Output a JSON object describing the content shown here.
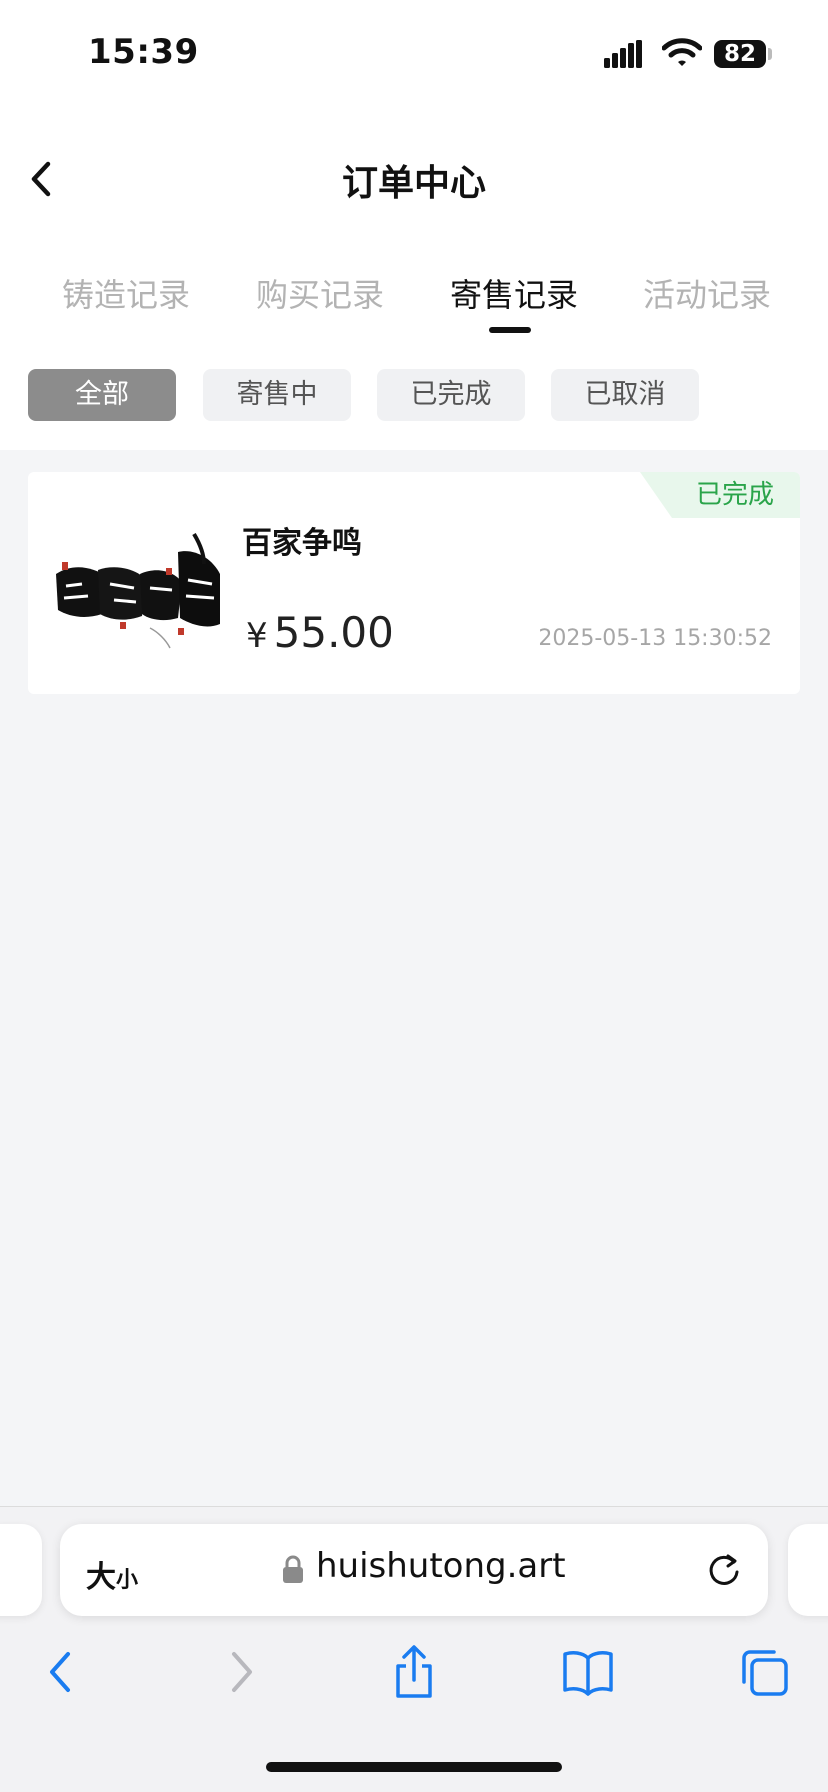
{
  "status_bar": {
    "time": "15:39",
    "battery": "82"
  },
  "header": {
    "title": "订单中心"
  },
  "tabs": [
    {
      "label": "铸造记录",
      "active": false
    },
    {
      "label": "购买记录",
      "active": false
    },
    {
      "label": "寄售记录",
      "active": true
    },
    {
      "label": "活动记录",
      "active": false
    }
  ],
  "filters": [
    {
      "label": "全部",
      "active": true
    },
    {
      "label": "寄售中",
      "active": false
    },
    {
      "label": "已完成",
      "active": false
    },
    {
      "label": "已取消",
      "active": false
    }
  ],
  "orders": [
    {
      "name": "百家争鸣",
      "currency": "¥",
      "price": "55.00",
      "time": "2025-05-13 15:30:52",
      "status": "已完成"
    }
  ],
  "browser": {
    "text_size_big": "大",
    "text_size_small": "小",
    "url": "huishutong.art"
  },
  "colors": {
    "accent_dark": "#111111",
    "status_completed": "#2aa44a",
    "status_completed_bg": "#e8f7ec",
    "ios_blue": "#1a7cf0",
    "page_bg": "#f4f5f7"
  }
}
